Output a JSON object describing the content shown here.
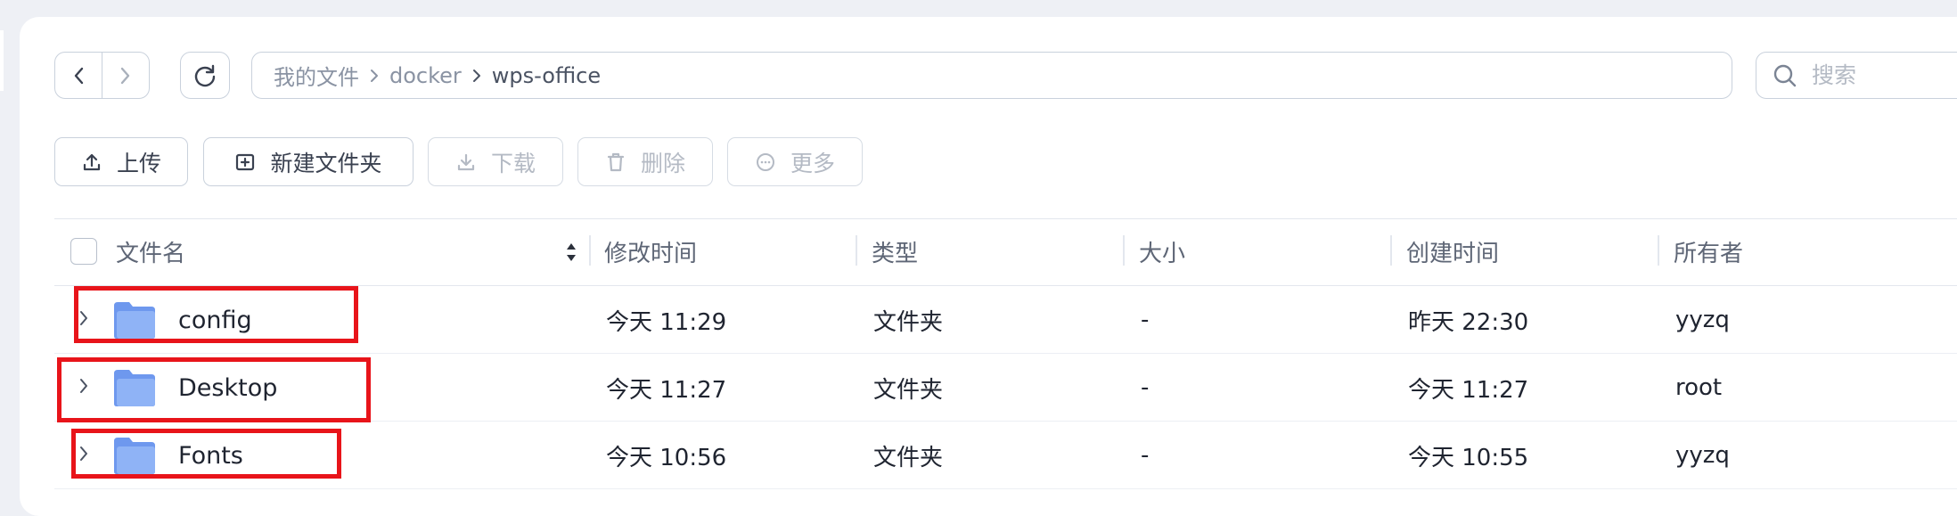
{
  "toolbar_top": {
    "back_button": "back",
    "forward_button": "forward",
    "refresh_button": "refresh",
    "breadcrumb": [
      "我的文件",
      "docker",
      "wps-office"
    ],
    "search_placeholder": "搜索"
  },
  "actions": {
    "upload_label": "上传",
    "new_folder_label": "新建文件夹",
    "download_label": "下载",
    "delete_label": "删除",
    "more_label": "更多"
  },
  "table": {
    "columns": {
      "name": "文件名",
      "modified": "修改时间",
      "type": "类型",
      "size": "大小",
      "created": "创建时间",
      "owner": "所有者"
    },
    "rows": [
      {
        "name": "config",
        "modified": "今天 11:29",
        "type": "文件夹",
        "size": "-",
        "created": "昨天 22:30",
        "owner": "yyzq"
      },
      {
        "name": "Desktop",
        "modified": "今天 11:27",
        "type": "文件夹",
        "size": "-",
        "created": "今天 11:27",
        "owner": "root"
      },
      {
        "name": "Fonts",
        "modified": "今天 10:56",
        "type": "文件夹",
        "size": "-",
        "created": "今天 10:55",
        "owner": "yyzq"
      }
    ]
  },
  "icons": {
    "folder": "folder-icon",
    "expander": "chevron-right-icon",
    "search": "search-icon",
    "refresh": "refresh-icon"
  },
  "colors": {
    "folder_blue": "#7ea6f4",
    "highlight_red": "#e8141a",
    "border": "#c9d1dc"
  }
}
